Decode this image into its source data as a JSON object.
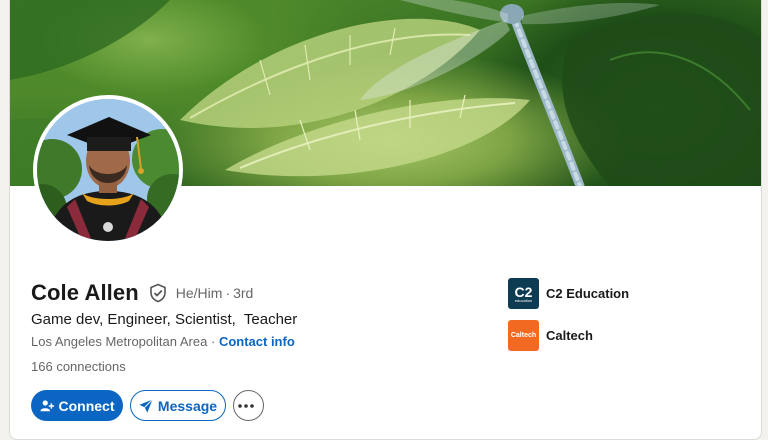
{
  "profile": {
    "name": "Cole Allen",
    "pronouns": "He/Him",
    "separator": "·",
    "degree": "3rd",
    "headline": "Game dev, Engineer, Scientist,  Teacher",
    "location": "Los Angeles Metropolitan Area",
    "location_separator": "·",
    "contact_info": "Contact info",
    "connections_count": "166",
    "connections_label": "connections"
  },
  "actions": {
    "connect_label": "Connect",
    "message_label": "Message",
    "more_icon": "ellipsis-icon"
  },
  "organizations": [
    {
      "name": "C2 Education",
      "logo_text": "C2",
      "logo_subtext": "education",
      "logo_color": "#0d3b52"
    },
    {
      "name": "Caltech",
      "logo_text": "Caltech",
      "logo_color": "#f26a21"
    }
  ],
  "colors": {
    "accent": "#0a66c2",
    "muted_text": "#666666",
    "page_background": "#f4f2ee"
  }
}
